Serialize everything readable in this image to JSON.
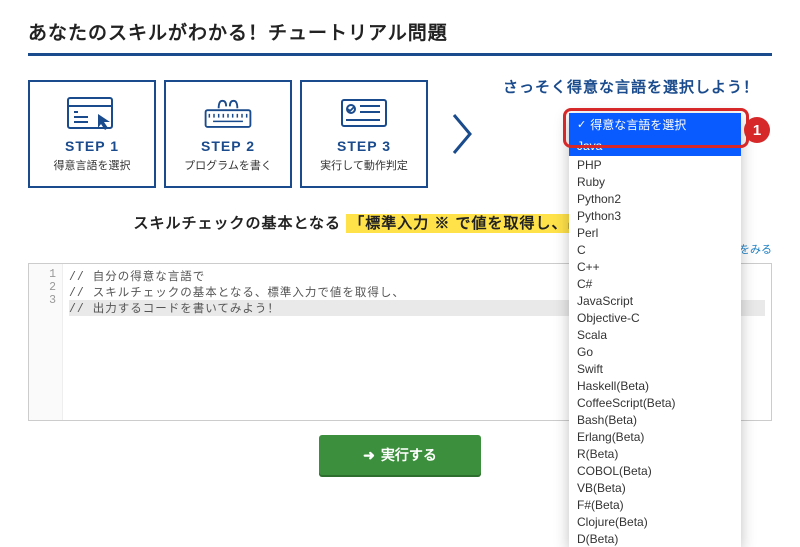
{
  "title": "あなたのスキルがわかる！チュートリアル問題",
  "steps": [
    {
      "name": "STEP 1",
      "desc": "得意言語を選択"
    },
    {
      "name": "STEP 2",
      "desc": "プログラムを書く"
    },
    {
      "name": "STEP 3",
      "desc": "実行して動作判定"
    }
  ],
  "cta": "さっそく得意な言語を選択しよう！",
  "subhead_pre": "スキルチェックの基本となる",
  "subhead_hl": "「標準入力 ※ で値を取得し、出力するコー",
  "note_symbol": "※",
  "note_link": "ドをみる",
  "code": [
    "// 自分の得意な言語で",
    "// スキルチェックの基本となる、標準入力で値を取得し、",
    "// 出力するコードを書いてみよう！"
  ],
  "line_numbers": [
    "1",
    "2",
    "3"
  ],
  "run_label": "実行する",
  "dropdown": {
    "selected": "得意な言語を選択",
    "hover": "Java",
    "items": [
      "PHP",
      "Ruby",
      "Python2",
      "Python3",
      "Perl",
      "C",
      "C++",
      "C#",
      "JavaScript",
      "Objective-C",
      "Scala",
      "Go",
      "Swift",
      "Haskell(Beta)",
      "CoffeeScript(Beta)",
      "Bash(Beta)",
      "Erlang(Beta)",
      "R(Beta)",
      "COBOL(Beta)",
      "VB(Beta)",
      "F#(Beta)",
      "Clojure(Beta)",
      "D(Beta)"
    ]
  },
  "callout_number": "1"
}
